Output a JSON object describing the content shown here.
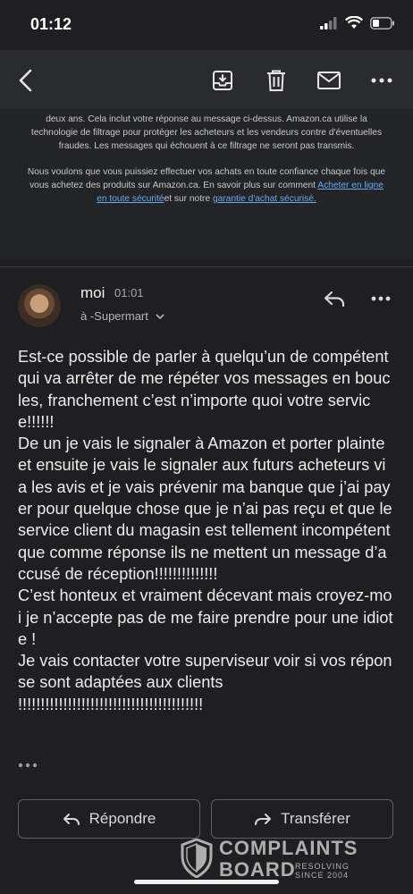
{
  "status_bar": {
    "time": "01:12"
  },
  "toolbar": {
    "back_icon": "chevron-left-icon",
    "archive_icon": "archive-icon",
    "delete_icon": "trash-icon",
    "mark_unread_icon": "envelope-icon",
    "more_icon": "more-horizontal-icon"
  },
  "quoted": {
    "line1": "deux ans. Cela inclut votre réponse au message ci-dessus. Amazon.ca utilise la technologie de filtrage pour protéger les acheteurs et les vendeurs contre d'éventuelles fraudes. Les messages qui échouent à ce filtrage ne seront pas transmis.",
    "line2_pre": "Nous voulons que vous puissiez effectuer vos achats en toute confiance chaque fois que vous achetez des produits sur Amazon.ca. En savoir plus sur comment ",
    "link1": "Acheter en ligne en toute sécurité",
    "line2_mid": "et sur notre ",
    "link2": "garantie d'achat sécurisé."
  },
  "message": {
    "sender": "moi",
    "time": "01:01",
    "recipient": "à -Supermart",
    "body": "Est-ce possible de parler à quelqu’un de compétent qui va arrêter de me répéter vos messages en boucles, franchement c’est n’importe quoi votre service!!!!!!\nDe un je vais le signaler à Amazon et porter plainte et ensuite je vais le signaler aux futurs acheteurs via les avis et je vais prévenir ma banque que j’ai payer pour quelque chose que je n’ai pas reçu et que le service client du magasin est tellement incompétent que comme réponse ils ne mettent un message d’accusé de réception!!!!!!!!!!!!!!\nC’est honteux et vraiment décevant mais croyez-moi je n’accepte pas de me faire prendre pour une idiote !\nJe vais contacter votre superviseur voir si vos réponse sont adaptées aux clients\n!!!!!!!!!!!!!!!!!!!!!!!!!!!!!!!!!!!!!!!!!"
  },
  "actions": {
    "reply_label": "Répondre",
    "forward_label": "Transférer"
  },
  "watermark": {
    "line1": "COMPLAINTS",
    "line2": "BOARD",
    "tagline1": "RESOLVING",
    "tagline2": "SINCE 2004"
  }
}
